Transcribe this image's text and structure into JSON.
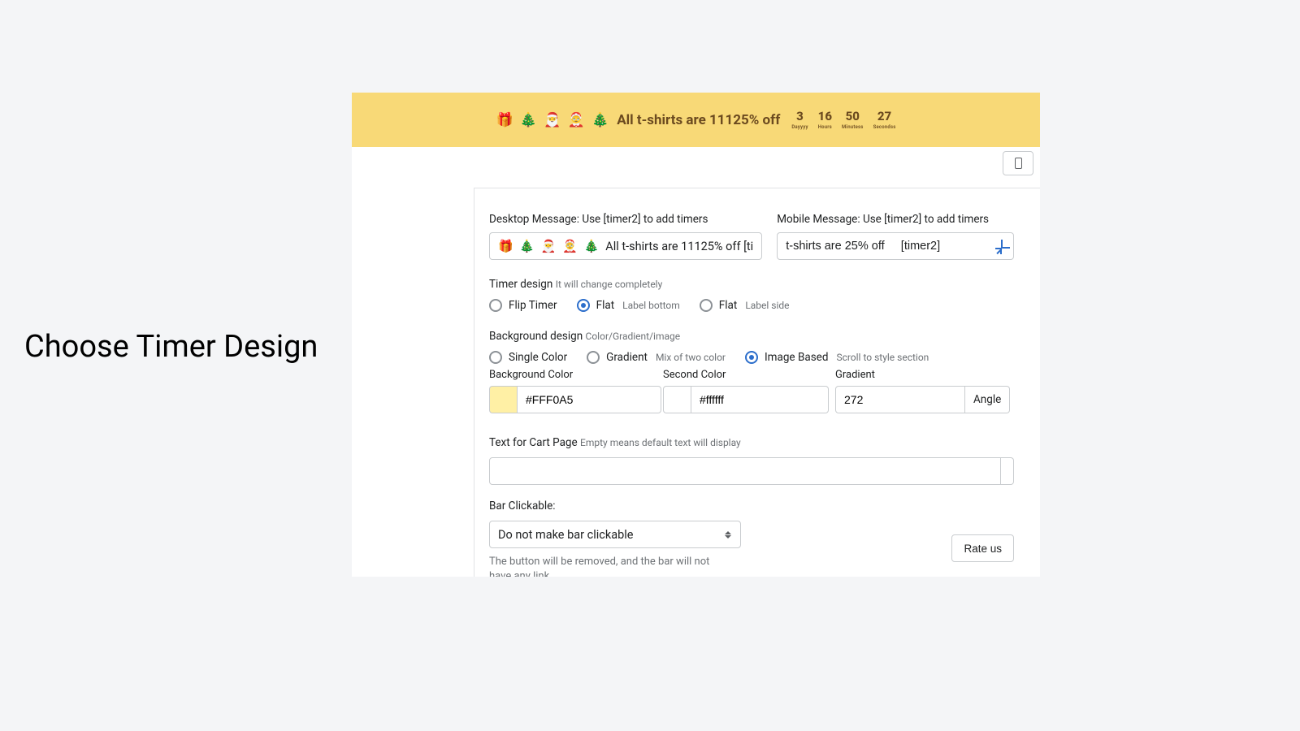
{
  "side": {
    "title": "Choose Timer Design"
  },
  "promo": {
    "icons": "🎁 🎄 🎅 🤶 🎄",
    "text": "All t-shirts are 11125% off",
    "countdown": [
      {
        "num": "3",
        "lbl": "Dayyyy"
      },
      {
        "num": "16",
        "lbl": "Hours"
      },
      {
        "num": "50",
        "lbl": "Minutess"
      },
      {
        "num": "27",
        "lbl": "Secondss"
      }
    ]
  },
  "form": {
    "desktop_label": "Desktop Message: Use [timer2] to add timers",
    "desktop_icons": "🎁 🎄 🎅 🤶 🎄",
    "desktop_value": "All t-shirts are 11125% off    [ti",
    "mobile_label": "Mobile Message: Use [timer2] to add timers",
    "mobile_value": "t-shirts are 25% off     [timer2]",
    "timer_design_label": "Timer design",
    "timer_design_hint": "It will change completely",
    "radios_design": [
      {
        "label": "Flip Timer",
        "sub": "",
        "selected": false
      },
      {
        "label": "Flat",
        "sub": "Label bottom",
        "selected": true
      },
      {
        "label": "Flat",
        "sub": "Label side",
        "selected": false
      }
    ],
    "bg_label": "Background design",
    "bg_hint": "Color/Gradient/image",
    "radios_bg": [
      {
        "label": "Single Color",
        "sub": "",
        "selected": false
      },
      {
        "label": "Gradient",
        "sub": "Mix of two color",
        "selected": false
      },
      {
        "label": "Image Based",
        "sub": "Scroll to style section",
        "selected": true
      }
    ],
    "bg_color_label": "Background Color",
    "bg_color_swatch": "#FFF0A5",
    "bg_color_value": "#FFF0A5",
    "second_color_label": "Second Color",
    "second_color_swatch": "#ffffff",
    "second_color_value": "#ffffff",
    "gradient_label": "Gradient",
    "gradient_value": "272",
    "gradient_suffix": "Angle",
    "cart_label": "Text for Cart Page",
    "cart_hint": "Empty means default text will display",
    "cart_value": "",
    "bar_clickable_label": "Bar Clickable:",
    "bar_clickable_value": "Do not make bar clickable",
    "bar_clickable_help": "The button will be removed, and the bar will not have any link",
    "rate_us": "Rate us"
  }
}
